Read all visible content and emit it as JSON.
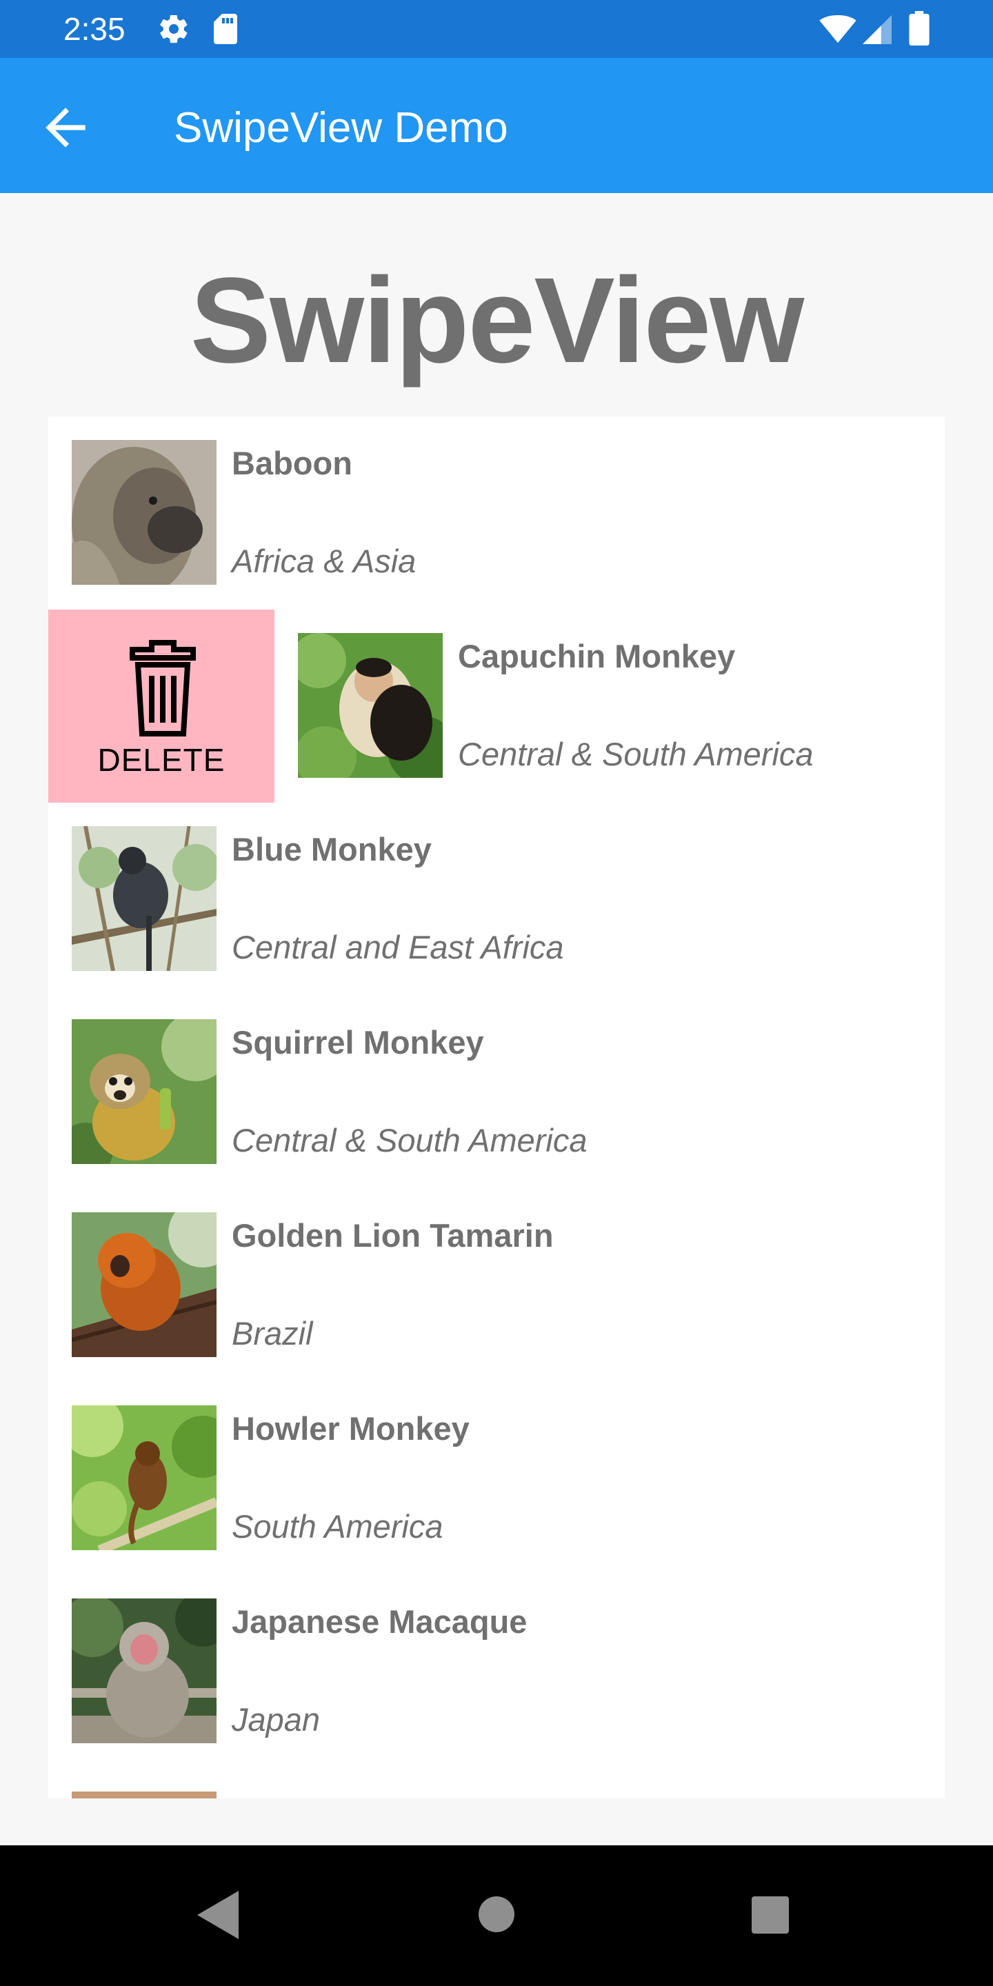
{
  "status_bar": {
    "time": "2:35",
    "icons": [
      "gear-icon",
      "sd-card-icon",
      "wifi-icon",
      "signal-icon",
      "battery-icon"
    ]
  },
  "app_bar": {
    "title": "SwipeView Demo",
    "back_icon": "arrow-left-icon"
  },
  "heading": "SwipeView",
  "colors": {
    "status_bar": "#1976d2",
    "app_bar": "#2196f3",
    "delete_background": "#ffb6c1",
    "text": "#707070"
  },
  "list": {
    "items": [
      {
        "name": "Baboon",
        "location": "Africa & Asia"
      },
      {
        "name": "Capuchin Monkey",
        "location": "Central & South America"
      },
      {
        "name": "Blue Monkey",
        "location": "Central and East Africa"
      },
      {
        "name": "Squirrel Monkey",
        "location": "Central & South America"
      },
      {
        "name": "Golden Lion Tamarin",
        "location": "Brazil"
      },
      {
        "name": "Howler Monkey",
        "location": "South America"
      },
      {
        "name": "Japanese Macaque",
        "location": "Japan"
      }
    ],
    "swipe_action": {
      "label": "DELETE",
      "icon": "trash-icon"
    }
  },
  "nav_bar": {
    "icons": [
      "nav-back-icon",
      "nav-home-icon",
      "nav-recents-icon"
    ]
  }
}
